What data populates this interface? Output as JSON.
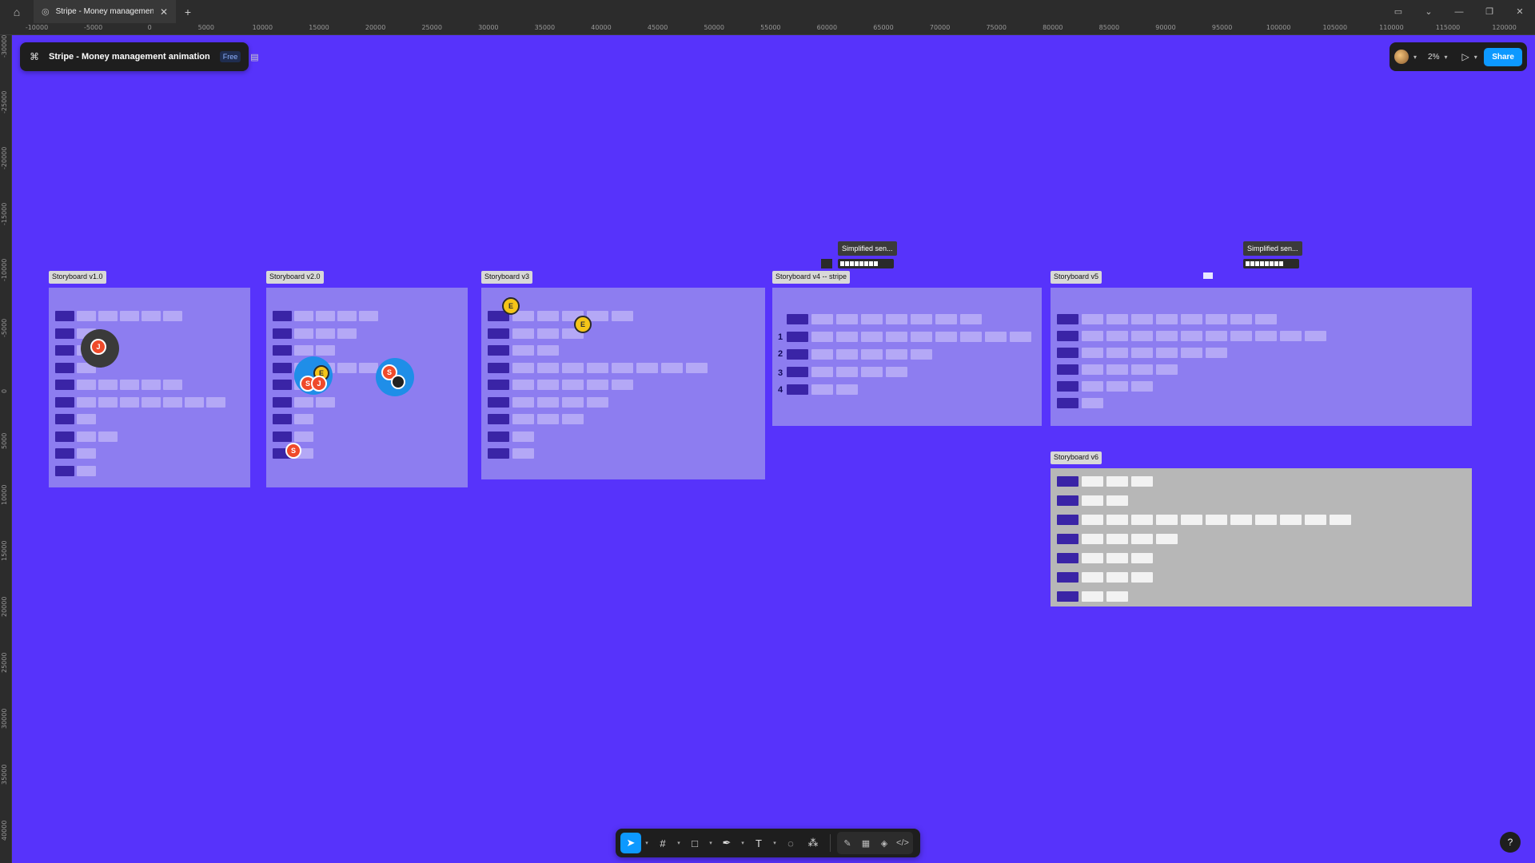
{
  "window": {
    "tab_title": "Stripe - Money management ani",
    "home_icon": "home-icon",
    "plus_label": "+",
    "close_label": "✕"
  },
  "ruler": {
    "top": [
      "-10000",
      "-5000",
      "0",
      "5000",
      "10000",
      "15000",
      "20000",
      "25000",
      "30000",
      "35000",
      "40000",
      "45000",
      "50000",
      "55000",
      "60000",
      "65000",
      "70000",
      "75000",
      "80000",
      "85000",
      "90000",
      "95000",
      "100000",
      "105000",
      "110000",
      "115000",
      "120000"
    ],
    "left": [
      "-30000",
      "-25000",
      "-20000",
      "-15000",
      "-10000",
      "-5000",
      "0",
      "5000",
      "10000",
      "15000",
      "20000",
      "25000",
      "30000",
      "35000",
      "40000"
    ]
  },
  "file_header": {
    "name": "Stripe - Money management animation",
    "badge": "Free"
  },
  "top_right": {
    "zoom": "2%",
    "share_label": "Share"
  },
  "frames": {
    "v1": "Storyboard v1.0",
    "v2": "Storyboard v2.0",
    "v3": "Storyboard v3",
    "v4": "Storyboard v4 -- stripe",
    "v5": "Storyboard v5",
    "v6": "Storyboard v6"
  },
  "row_numbers": [
    "1",
    "2",
    "3",
    "4"
  ],
  "notes": {
    "note1": "Simplified sen...",
    "note2": "Simplified sen..."
  },
  "cursors": {
    "e1": "E",
    "e2": "E",
    "j1": "J",
    "s1": "S",
    "j2": "J",
    "e3": "E",
    "s2": "S",
    "s3": "S"
  },
  "help_label": "?",
  "colors": {
    "canvas": "#5733fb",
    "frame": "#8d7df0",
    "frame_gray": "#b7b7b7",
    "accent": "#0d99ff"
  }
}
